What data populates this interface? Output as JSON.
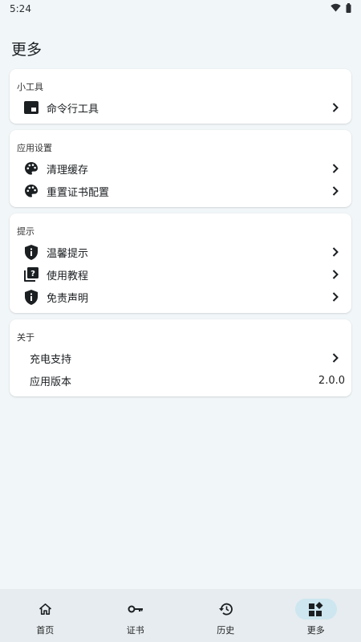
{
  "status": {
    "time": "5:24"
  },
  "page_title": "更多",
  "sections": {
    "tools": {
      "title": "小工具",
      "items": [
        {
          "label": "命令行工具",
          "icon": "terminal-window-icon"
        }
      ]
    },
    "settings": {
      "title": "应用设置",
      "items": [
        {
          "label": "清理缓存",
          "icon": "palette-icon"
        },
        {
          "label": "重置证书配置",
          "icon": "palette-icon"
        }
      ]
    },
    "tips": {
      "title": "提示",
      "items": [
        {
          "label": "温馨提示",
          "icon": "shield-info-icon"
        },
        {
          "label": "使用教程",
          "icon": "help-book-icon"
        },
        {
          "label": "免责声明",
          "icon": "shield-info-icon"
        }
      ]
    },
    "about": {
      "title": "关于",
      "items": [
        {
          "label": "充电支持"
        },
        {
          "label": "应用版本",
          "value": "2.0.0"
        }
      ]
    }
  },
  "bottom_nav": [
    {
      "label": "首页",
      "icon": "home-icon"
    },
    {
      "label": "证书",
      "icon": "key-icon"
    },
    {
      "label": "历史",
      "icon": "history-icon"
    },
    {
      "label": "更多",
      "icon": "widgets-icon",
      "active": true
    }
  ],
  "colors": {
    "background": "#f1f6f8",
    "nav_active": "#cde6ef",
    "nav_bar": "#e6ecef"
  }
}
